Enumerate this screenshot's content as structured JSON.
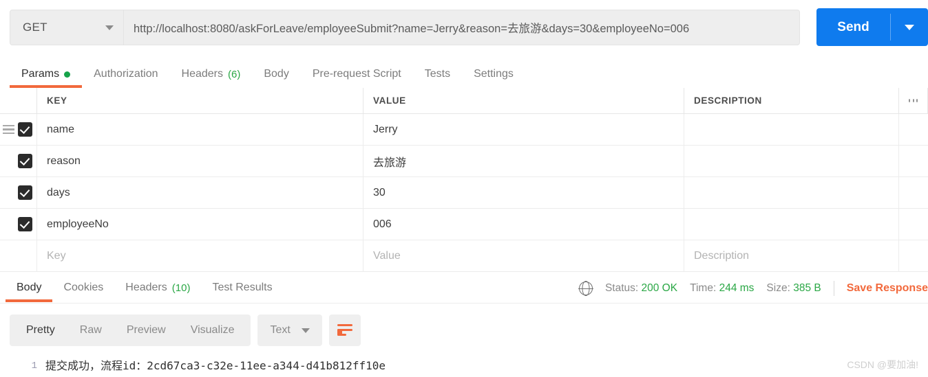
{
  "request": {
    "method": "GET",
    "url": "http://localhost:8080/askForLeave/employeeSubmit?name=Jerry&reason=去旅游&days=30&employeeNo=006",
    "send_label": "Send",
    "tabs": [
      {
        "label": "Params",
        "badge": "",
        "dot": true,
        "active": true
      },
      {
        "label": "Authorization",
        "badge": "",
        "dot": false,
        "active": false
      },
      {
        "label": "Headers",
        "badge": "(6)",
        "dot": false,
        "active": false
      },
      {
        "label": "Body",
        "badge": "",
        "dot": false,
        "active": false
      },
      {
        "label": "Pre-request Script",
        "badge": "",
        "dot": false,
        "active": false
      },
      {
        "label": "Tests",
        "badge": "",
        "dot": false,
        "active": false
      },
      {
        "label": "Settings",
        "badge": "",
        "dot": false,
        "active": false
      }
    ]
  },
  "params_table": {
    "columns": {
      "key": "KEY",
      "value": "VALUE",
      "description": "DESCRIPTION"
    },
    "rows": [
      {
        "checked": true,
        "key": "name",
        "value": "Jerry",
        "description": ""
      },
      {
        "checked": true,
        "key": "reason",
        "value": "去旅游",
        "description": ""
      },
      {
        "checked": true,
        "key": "days",
        "value": "30",
        "description": ""
      },
      {
        "checked": true,
        "key": "employeeNo",
        "value": "006",
        "description": ""
      }
    ],
    "placeholder_row": {
      "key": "Key",
      "value": "Value",
      "description": "Description"
    }
  },
  "response": {
    "tabs": [
      {
        "label": "Body",
        "badge": "",
        "active": true
      },
      {
        "label": "Cookies",
        "badge": "",
        "active": false
      },
      {
        "label": "Headers",
        "badge": "(10)",
        "active": false
      },
      {
        "label": "Test Results",
        "badge": "",
        "active": false
      }
    ],
    "meta": {
      "status_label": "Status:",
      "status_value": "200 OK",
      "time_label": "Time:",
      "time_value": "244 ms",
      "size_label": "Size:",
      "size_value": "385 B",
      "save_label": "Save Response"
    },
    "view_modes": [
      {
        "label": "Pretty",
        "active": true
      },
      {
        "label": "Raw",
        "active": false
      },
      {
        "label": "Preview",
        "active": false
      },
      {
        "label": "Visualize",
        "active": false
      }
    ],
    "format": "Text",
    "line_number": "1",
    "body_text": "提交成功，流程id：2cd67ca3-c32e-11ee-a344-d41b812ff10e"
  },
  "watermark": "CSDN @要加油!",
  "colors": {
    "accent_orange": "#f2693c",
    "send_blue": "#0f7bee",
    "status_green": "#2aa745"
  }
}
